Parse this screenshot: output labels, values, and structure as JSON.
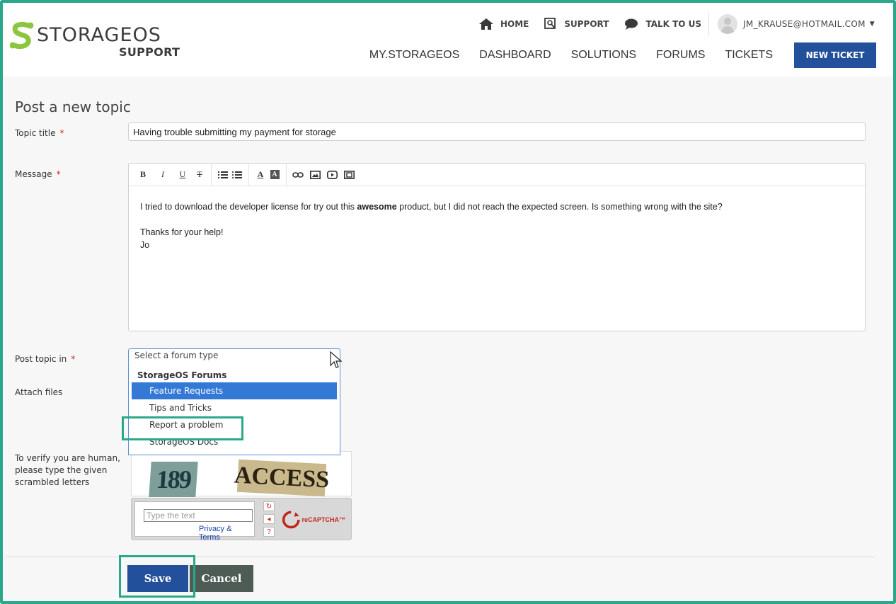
{
  "header": {
    "logo_word_a": "STORAGE",
    "logo_word_b": "OS",
    "logo_sub": "SUPPORT",
    "toplinks": [
      {
        "label": "HOME",
        "icon": "home-icon"
      },
      {
        "label": "SUPPORT",
        "icon": "support-icon"
      },
      {
        "label": "TALK TO US",
        "icon": "chat-icon"
      }
    ],
    "user": {
      "email": "JM_KRAUSE@HOTMAIL.COM",
      "icon": "avatar"
    },
    "nav": [
      "MY.STORAGEOS",
      "DASHBOARD",
      "SOLUTIONS",
      "FORUMS",
      "TICKETS"
    ],
    "new_ticket": "NEW TICKET"
  },
  "form": {
    "title": "Post a new topic",
    "topic_label": "Topic title",
    "topic_value": "Having trouble submitting my payment for storage",
    "message_label": "Message",
    "toolbar": [
      "B",
      "I",
      "U",
      "T",
      "bullet-list",
      "numbered-list",
      "A",
      "A",
      "link",
      "image",
      "video",
      "embed"
    ],
    "message": {
      "line1_pre": "I tried to download the developer license for try out this ",
      "line1_bold": "awesome",
      "line1_post": " product, but I did not reach the expected screen. Is something wrong with the site?",
      "line2": "Thanks for your help!",
      "line3": "Jo"
    },
    "post_in_label": "Post topic in",
    "select_placeholder": "Select a forum type",
    "dropdown": {
      "group": "StorageOS Forums",
      "options": [
        "Feature Requests",
        "Tips and Tricks",
        "Report a problem",
        "StorageOS Docs"
      ],
      "highlighted": "Feature Requests"
    },
    "attach_label": "Attach files",
    "captcha_label": "To verify you are human, please type the given scrambled letters",
    "captcha": {
      "img_text_1": "189",
      "img_text_2": "ACCESS",
      "input_placeholder": "Type the text",
      "privacy": "Privacy & Terms",
      "logo_text": "reCAPTCHA™"
    },
    "required_mark": "*",
    "save": "Save",
    "cancel": "Cancel"
  },
  "colors": {
    "accent": "#23509b",
    "highlight": "#2aa889",
    "brand_green": "#8cc63f",
    "required": "#d0201a"
  }
}
